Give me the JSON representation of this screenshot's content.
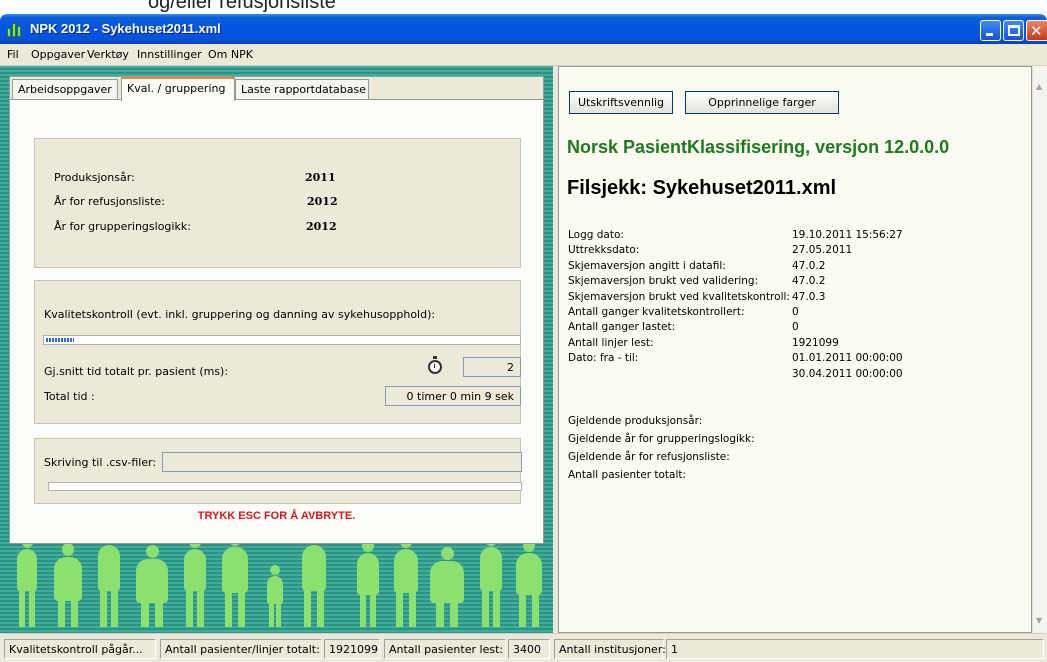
{
  "top_strip": {
    "text": "og/eller refusjonsliste"
  },
  "window": {
    "title": "NPK 2012  - Sykehuset2011.xml"
  },
  "menu": [
    "Fil",
    "Oppgaver",
    "Verktøy",
    "Innstillinger",
    "Om NPK"
  ],
  "tabs": [
    {
      "label": "Arbeidsoppgaver"
    },
    {
      "label": "Kval. / gruppering"
    },
    {
      "label": "Laste rapportdatabase"
    }
  ],
  "years": {
    "produksjonsar_label": "Produksjonsår:",
    "produksjonsar_value": "2011",
    "refusjonsliste_label": "År for refusjonsliste:",
    "refusjonsliste_value": "2012",
    "grupperingslogikk_label": "År for grupperingslogikk:",
    "grupperingslogikk_value": "2012"
  },
  "quality": {
    "label": "Kvalitetskontroll (evt. inkl. gruppering og danning av sykehusopphold):",
    "progress_fraction": 0.06,
    "avg_time_label": "Gj.snitt tid totalt pr. pasient (ms):",
    "avg_time_value": "2",
    "total_time_label": "Total tid :",
    "total_time_value": "0 timer 0 min 9 sek"
  },
  "csv": {
    "label": "Skriving til .csv-filer:",
    "value": "",
    "progress_fraction": 0
  },
  "abort_text": "TRYKK ESC FOR Å AVBRYTE.",
  "report": {
    "button_print": "Utskriftsvennlig",
    "button_colors": "Opprinnelige farger",
    "heading": "Norsk PasientKlassifisering, versjon 12.0.0.0",
    "subheading": "Filsjekk: Sykehuset2011.xml",
    "rows": [
      {
        "label": "Logg dato:",
        "value": "19.10.2011 15:56:27"
      },
      {
        "label": "Uttrekksdato:",
        "value": "27.05.2011"
      },
      {
        "label": "Skjemaversjon angitt i datafil:",
        "value": "47.0.2"
      },
      {
        "label": "Skjemaversjon brukt ved validering:",
        "value": "47.0.2"
      },
      {
        "label": "Skjemaversjon brukt ved kvalitetskontroll:",
        "value": "47.0.3"
      },
      {
        "label": "Antall ganger kvalitetskontrollert:",
        "value": "0"
      },
      {
        "label": "Antall ganger lastet:",
        "value": "0"
      },
      {
        "label": "Antall linjer lest:",
        "value": "1921099"
      },
      {
        "label": "Dato: fra - til:",
        "value": "01.01.2011 00:00:00"
      },
      {
        "label": "",
        "value": "30.04.2011 00:00:00"
      }
    ],
    "rows2": [
      {
        "label": "Gjeldende produksjonsår:"
      },
      {
        "label": "Gjeldende år for grupperingslogikk:"
      },
      {
        "label": "Gjeldende år for refusjonsliste:"
      },
      {
        "label": "Antall pasienter totalt:"
      }
    ]
  },
  "status": {
    "state": "Kvalitetskontroll pågår...",
    "patients_total_label": "Antall pasienter/linjer totalt:",
    "patients_total_value": "1921099",
    "patients_read_label": "Antall pasienter lest:",
    "patients_read_value": "3400",
    "institutions_label": "Antall institusjoner:",
    "institutions_value": "1"
  },
  "colors": {
    "titlebar": "#0554e3",
    "report_heading": "#1d7a1d",
    "abort_text": "#d11a1a",
    "background_teal": "#3aa59a",
    "silhouettes": "#8be06e"
  }
}
